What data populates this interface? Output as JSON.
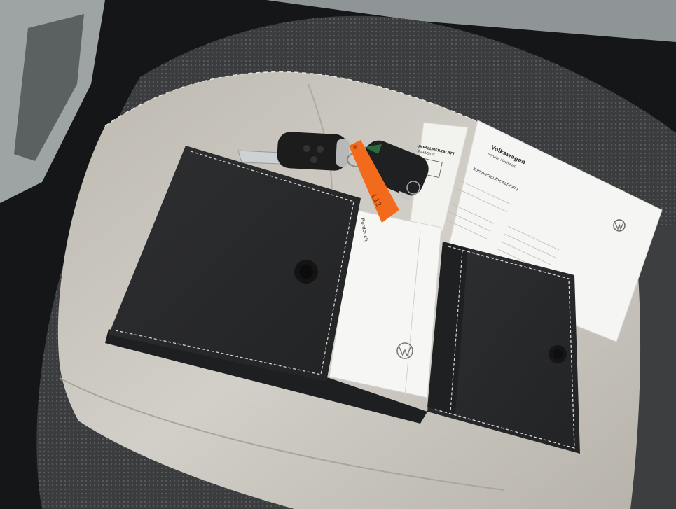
{
  "scene": {
    "description_alt": "Car key set and Volkswagen documentation on a car seat"
  },
  "documents": {
    "sheet_right": {
      "brand": "Volkswagen",
      "subtitle": "Service Nachweis",
      "heading": "Komplettaufbewahrung"
    },
    "sheet_left": {
      "heading": "UNFALLMERKBLATT",
      "subheading": "- FAHRZEUG -"
    },
    "booklet": {
      "spine_text": "Bordbuch"
    },
    "tag": {
      "handwriting": "L12"
    }
  },
  "colors": {
    "seat_light": "#c9c6bf",
    "seat_dark": "#3a3c3e",
    "wallet": "#2a2b2d",
    "tag_orange": "#f26a1b",
    "paper": "#f3f3f1"
  }
}
